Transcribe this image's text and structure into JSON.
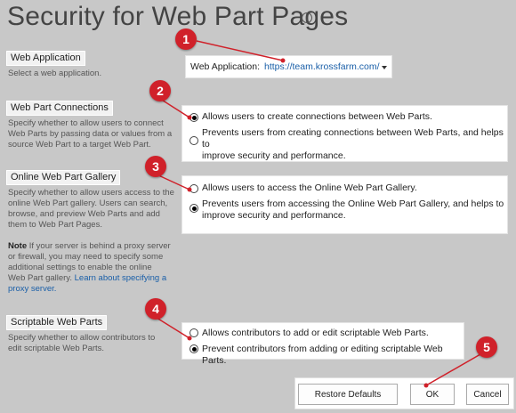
{
  "page": {
    "title": "Security for Web Part Pages",
    "info_icon": "info-icon"
  },
  "web_application": {
    "heading": "Web Application",
    "description": "Select a web application.",
    "label": "Web Application:",
    "value": "https://team.krossfarm.com/"
  },
  "connections": {
    "heading": "Web Part Connections",
    "description": [
      "Specify whether to allow users to connect",
      "Web Parts by passing data or values from a",
      "source Web Part to a target Web Part."
    ],
    "options": [
      {
        "lines": [
          "Allows users to create connections between Web Parts."
        ],
        "selected": true
      },
      {
        "lines": [
          "Prevents users from creating connections between Web Parts, and helps to",
          "improve security and performance."
        ],
        "selected": false
      }
    ]
  },
  "gallery": {
    "heading": "Online Web Part Gallery",
    "description": [
      "Specify whether to allow users access to the",
      "online Web Part gallery.  Users can search,",
      "browse, and preview Web Parts and add",
      "them to Web Part Pages."
    ],
    "note_bold": "Note",
    "note_lines": [
      " If your server is behind a proxy server",
      "or firewall, you may need to specify some",
      "additional settings to enable the online",
      "Web Part gallery. "
    ],
    "note_link_a": "Learn about specifying a",
    "note_link_b": "proxy server.",
    "options": [
      {
        "lines": [
          "Allows users to access the Online Web Part Gallery."
        ],
        "selected": false
      },
      {
        "lines": [
          "Prevents users from accessing the Online Web Part Gallery, and helps to",
          "improve security and performance."
        ],
        "selected": true
      }
    ]
  },
  "scriptable": {
    "heading": "Scriptable Web Parts",
    "description": [
      "Specify whether to allow contributors to",
      "edit scriptable Web Parts."
    ],
    "options": [
      {
        "lines": [
          "Allows contributors to add or edit scriptable Web Parts."
        ],
        "selected": false
      },
      {
        "lines": [
          "Prevent contributors from adding or editing scriptable Web Parts."
        ],
        "selected": true
      }
    ]
  },
  "buttons": {
    "restore": "Restore Defaults",
    "ok": "OK",
    "cancel": "Cancel"
  },
  "callouts": [
    "1",
    "2",
    "3",
    "4",
    "5"
  ],
  "colors": {
    "callout": "#d0212a",
    "background": "#c8c8c8",
    "link": "#1a5fa8"
  }
}
